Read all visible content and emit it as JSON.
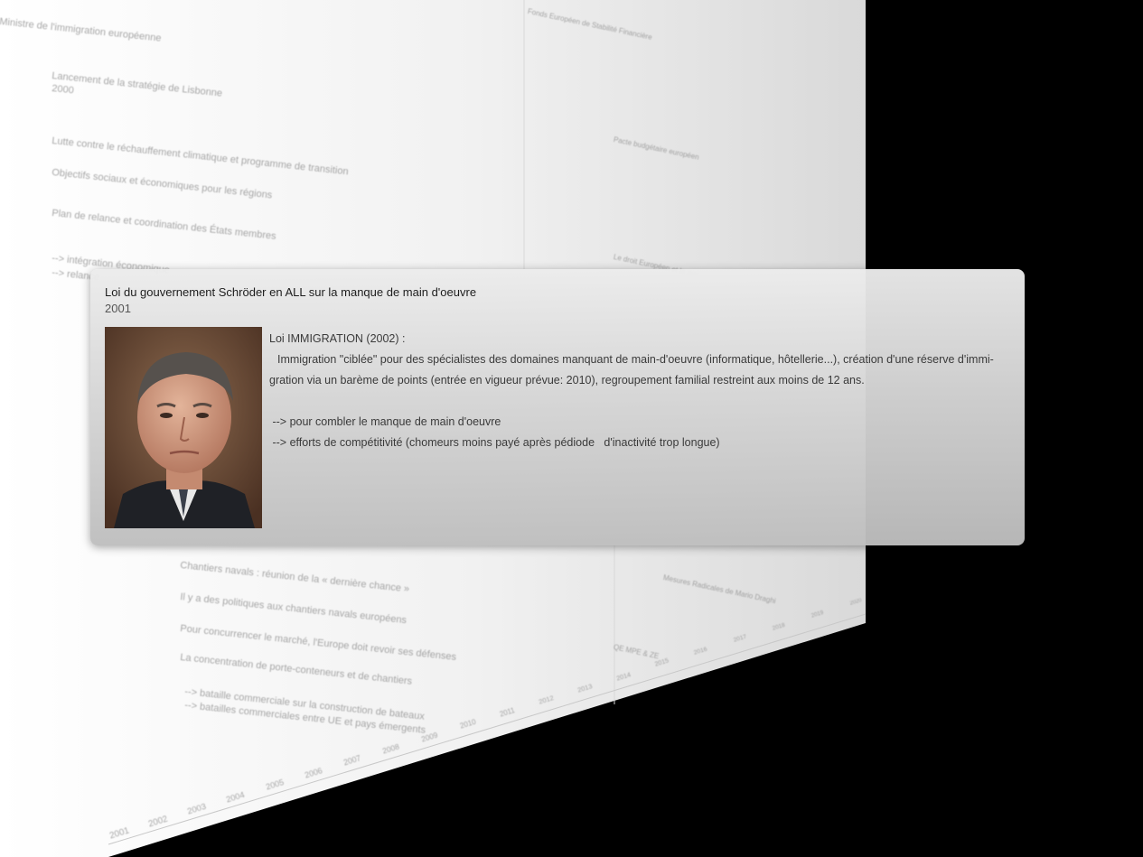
{
  "backdrop": {
    "lines": [
      "Ministre de l'immigration européenne",
      "Lancement de la stratégie de Lisbonne",
      "2000",
      "Lutte contre le réchauffement climatique et programme de transition",
      "Objectifs sociaux et économiques pour les régions",
      "Plan de relance et coordination des États membres",
      "--> intégration économique",
      "--> relance",
      "Chantiers navals : réunion de la « dernière chance »",
      "Il y a des politiques aux chantiers navals européens",
      "Pour concurrencer le marché, l'Europe doit revoir ses défenses",
      "La concentration de porte-conteneurs et de chantiers",
      "--> bataille commerciale sur la construction de bateaux",
      "--> batailles commerciales entre UE et pays émergents",
      "Fonds Européen de Stabilité Financière",
      "Pacte budgétaire européen",
      "Le droit Européen et la mer",
      "Mesures Radicales de Mario Draghi",
      "QE MPE & ZE"
    ],
    "years": [
      "2001",
      "2002",
      "2003",
      "2004",
      "2005",
      "2006",
      "2007",
      "2008",
      "2009",
      "2010",
      "2011",
      "2012",
      "2013",
      "2014",
      "2015",
      "2016",
      "2017",
      "2018",
      "2019",
      "2020"
    ]
  },
  "popup": {
    "title": "Loi du gouvernement Schröder en ALL sur la manque de main d'oeuvre",
    "date": "2001",
    "body": {
      "heading": "Loi IMMIGRATION (2002) :",
      "paragraph": "Immigration \"ciblée\" pour des spécialistes des domaines manquant de  main-d'oeuvre (informatique, hôtellerie...), création d'une réserve  d'immi-gration via un barème de points (entrée en vigueur prévue: 2010),  regroupement familial restreint aux moins de 12 ans.",
      "bullet1": " --> pour combler le manque de main d'oeuvre",
      "bullet2": " --> efforts de compétitivité (chomeurs moins payé après pédiode   d'inactivité trop longue)"
    }
  },
  "colors": {
    "page": "#f2f2f2",
    "background": "#000000",
    "popup_text": "#1d1d1d"
  }
}
